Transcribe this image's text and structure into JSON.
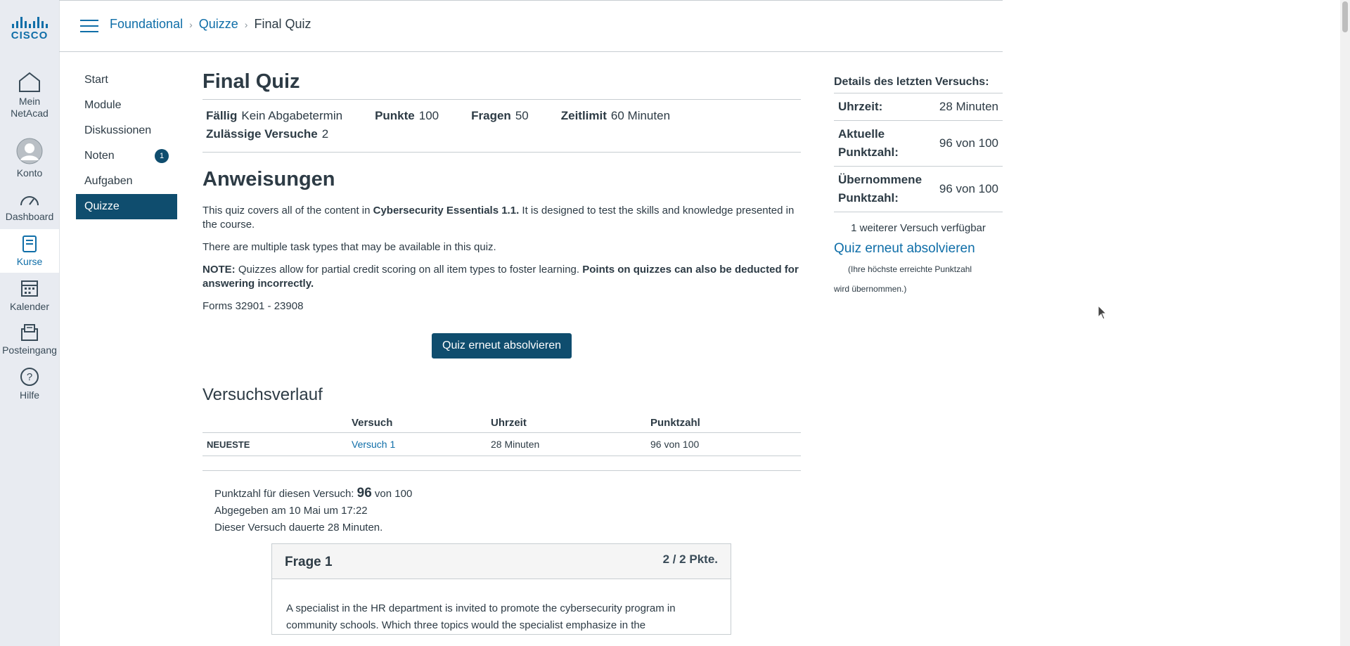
{
  "brand": {
    "logo_text": "CISCO",
    "accent": "#0f6ea8",
    "dark": "#0f4d6e"
  },
  "global_nav": [
    {
      "label_line1": "Mein",
      "label_line2": "NetAcad",
      "icon": "home-icon"
    },
    {
      "label_line1": "Konto",
      "label_line2": "",
      "icon": "avatar-icon"
    },
    {
      "label_line1": "Dashboard",
      "label_line2": "",
      "icon": "dashboard-icon"
    },
    {
      "label_line1": "Kurse",
      "label_line2": "",
      "icon": "courses-icon"
    },
    {
      "label_line1": "Kalender",
      "label_line2": "",
      "icon": "calendar-icon"
    },
    {
      "label_line1": "Posteingang",
      "label_line2": "",
      "icon": "inbox-icon"
    },
    {
      "label_line1": "Hilfe",
      "label_line2": "",
      "icon": "help-icon"
    }
  ],
  "breadcrumb": {
    "course": "Foundational",
    "section": "Quizze",
    "current": "Final Quiz"
  },
  "course_nav": {
    "items": [
      "Start",
      "Module",
      "Diskussionen",
      "Noten",
      "Aufgaben",
      "Quizze"
    ],
    "noten_badge": "1"
  },
  "quiz": {
    "title": "Final Quiz",
    "due_label": "Fällig",
    "due_value": "Kein Abgabetermin",
    "points_label": "Punkte",
    "points_value": "100",
    "questions_label": "Fragen",
    "questions_value": "50",
    "time_label": "Zeitlimit",
    "time_value": "60 Minuten",
    "attempts_label": "Zulässige Versuche",
    "attempts_value": "2"
  },
  "instructions": {
    "heading": "Anweisungen",
    "p1_a": "This quiz covers all of the content in ",
    "p1_b": "Cybersecurity Essentials 1.1.",
    "p1_c": " It is designed to test the skills and knowledge presented in the course.",
    "p2": "There are multiple task types that may be available in this quiz.",
    "p3_a": "NOTE:",
    "p3_b": " Quizzes allow for partial credit scoring on all item types to foster learning. ",
    "p3_c": "Points on quizzes can also be deducted for answering incorrectly.",
    "p4": "Forms 32901 - 23908",
    "retake_button": "Quiz erneut absolvieren"
  },
  "history": {
    "heading": "Versuchsverlauf",
    "columns": [
      "",
      "Versuch",
      "Uhrzeit",
      "Punktzahl"
    ],
    "row": {
      "tag": "NEUESTE",
      "attempt": "Versuch 1",
      "time": "28 Minuten",
      "score": "96 von 100"
    }
  },
  "summary": {
    "score_prefix": "Punktzahl für diesen Versuch: ",
    "score_value": "96",
    "score_suffix": " von 100",
    "submitted": "Abgegeben am 10 Mai um 17:22",
    "duration": "Dieser Versuch dauerte 28 Minuten."
  },
  "question1": {
    "title": "Frage 1",
    "points": "2 / 2 Pkte.",
    "text": "A specialist in the HR department is invited to promote the cybersecurity program in community schools. Which three topics would the specialist emphasize in the"
  },
  "side_panel": {
    "title": "Details des letzten Versuchs:",
    "rows": [
      {
        "label": "Uhrzeit:",
        "value": "28 Minuten"
      },
      {
        "label": "Aktuelle Punktzahl:",
        "value": "96 von 100"
      },
      {
        "label": "Übernommene Punktzahl:",
        "value": "96 von 100"
      }
    ],
    "available": "1 weiterer Versuch verfügbar",
    "retake_link": "Quiz erneut absolvieren",
    "note_line1": "(Ihre höchste erreichte Punktzahl",
    "note_line2": "wird übernommen.)"
  }
}
